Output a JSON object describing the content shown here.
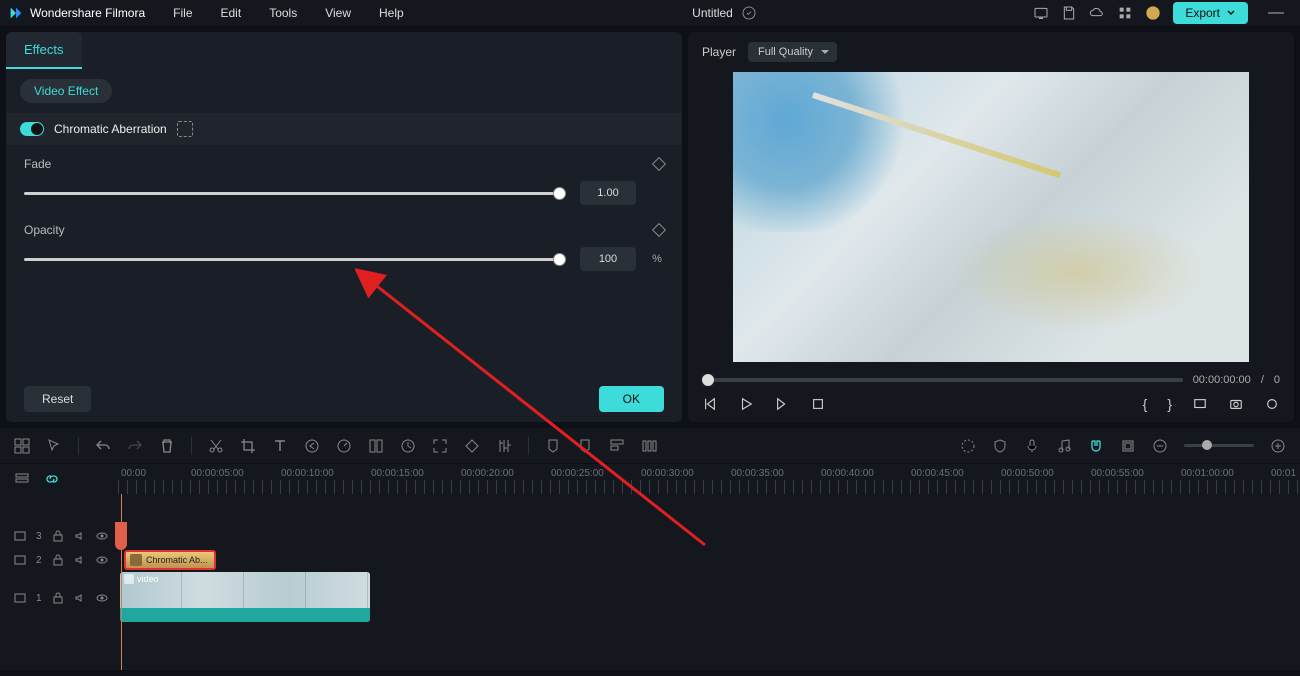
{
  "app": {
    "name": "Wondershare Filmora"
  },
  "menu": {
    "file": "File",
    "edit": "Edit",
    "tools": "Tools",
    "view": "View",
    "help": "Help"
  },
  "project": {
    "title": "Untitled"
  },
  "export": {
    "label": "Export"
  },
  "effects_panel": {
    "tab": "Effects",
    "filter_chip": "Video Effect",
    "effect_name": "Chromatic Aberration",
    "fade": {
      "label": "Fade",
      "value": "1.00"
    },
    "opacity": {
      "label": "Opacity",
      "value": "100",
      "unit": "%"
    },
    "reset": "Reset",
    "ok": "OK"
  },
  "player": {
    "label": "Player",
    "quality": "Full Quality",
    "timecode_current": "00:00:00:00",
    "timecode_sep": "/",
    "timecode_total": "0"
  },
  "timeline": {
    "ruler": [
      "00:00",
      "00:00:05:00",
      "00:00:10:00",
      "00:00:15:00",
      "00:00:20:00",
      "00:00:25:00",
      "00:00:30:00",
      "00:00:35:00",
      "00:00:40:00",
      "00:00:45:00",
      "00:00:50:00",
      "00:00:55:00",
      "00:01:00:00",
      "00:01"
    ],
    "track3": "3",
    "track2": "2",
    "track1": "1",
    "effect_clip": "Chromatic Ab...",
    "video_clip": "video"
  }
}
